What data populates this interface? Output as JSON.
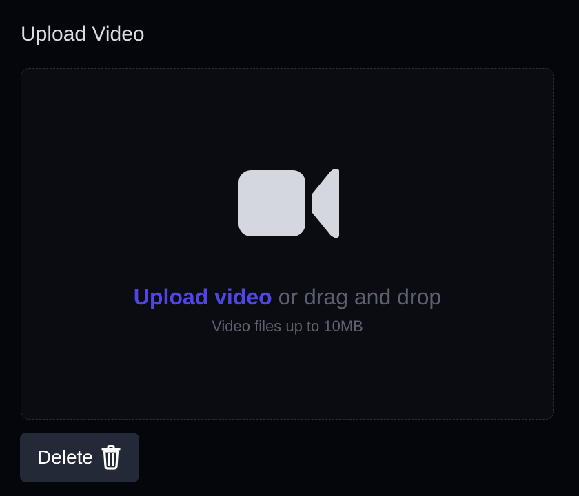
{
  "page": {
    "title": "Upload Video"
  },
  "dropzone": {
    "upload_link": "Upload video",
    "drag_text": "or drag and drop",
    "hint": "Video files up to 10MB",
    "icon": "video-camera-icon"
  },
  "actions": {
    "delete_label": "Delete",
    "delete_icon": "trash-icon"
  },
  "colors": {
    "background": "#05060b",
    "dropzone_bg": "#0b0c11",
    "accent": "#4f46e5",
    "muted_text": "#5c6170",
    "button_bg": "#232936"
  }
}
